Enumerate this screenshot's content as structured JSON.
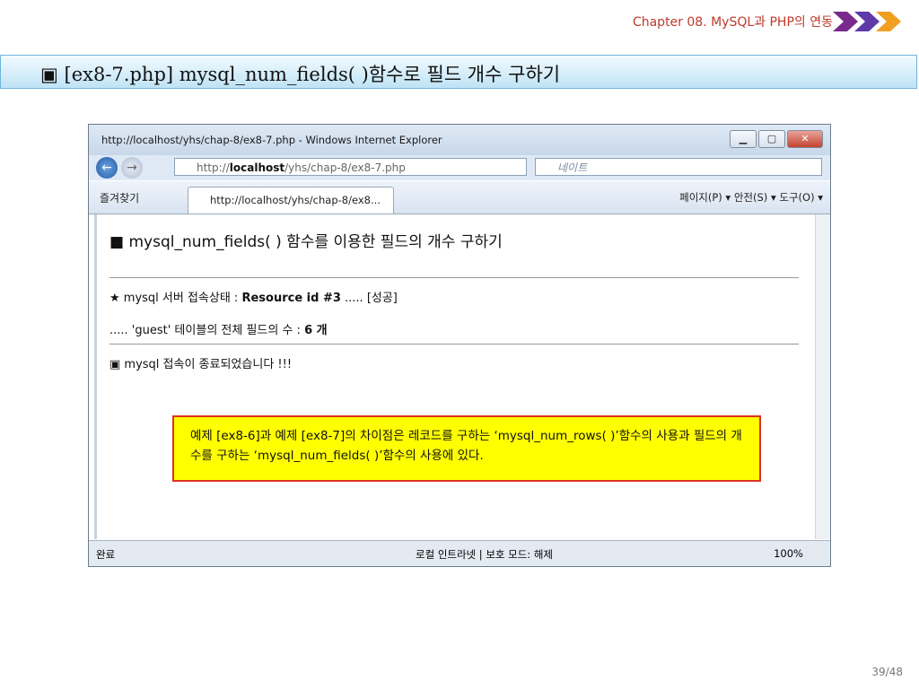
{
  "slide": {
    "chapter": "Chapter 08. MySQL과 PHP의 연동",
    "title": "▣ [ex8-7.php]  mysql_num_fields( )함수로 필드 개수 구하기",
    "page": "39/48",
    "note": "예제 [ex8-6]과 예제 [ex8-7]의 차이점은 레코드를 구하는 ‘mysql_num_rows( )’함수의 사용과 필드의 개수를 구하는 ‘mysql_num_fields( )’함수의 사용에 있다."
  },
  "browser": {
    "window_title": "http://localhost/yhs/chap-8/ex8-7.php - Windows Internet Explorer",
    "address_prefix": "http://",
    "address_host": "localhost",
    "address_path": "/yhs/chap-8/ex8-7.php",
    "search_placeholder": "네이트",
    "favorites": "즐겨찾기",
    "tab": "http://localhost/yhs/chap-8/ex8...",
    "tools": "페이지(P) ▾  안전(S) ▾  도구(O) ▾",
    "status_left": "완료",
    "status_mid": "로컬 인트라넷 | 보호 모드: 해제",
    "zoom": "100%"
  },
  "page": {
    "heading": "■ mysql_num_fields( ) 함수를 이용한 필드의 개수 구하기",
    "conn_label": "★ mysql 서버 접속상태 : ",
    "conn_value": "Resource id #3",
    "conn_suffix": " ..... [성공]",
    "fields_label": "..... 'guest' 테이블의 전체 필드의 수 : ",
    "fields_value": "6 개",
    "close_msg": "▣ mysql 접속이 종료되었습니다 !!!"
  }
}
